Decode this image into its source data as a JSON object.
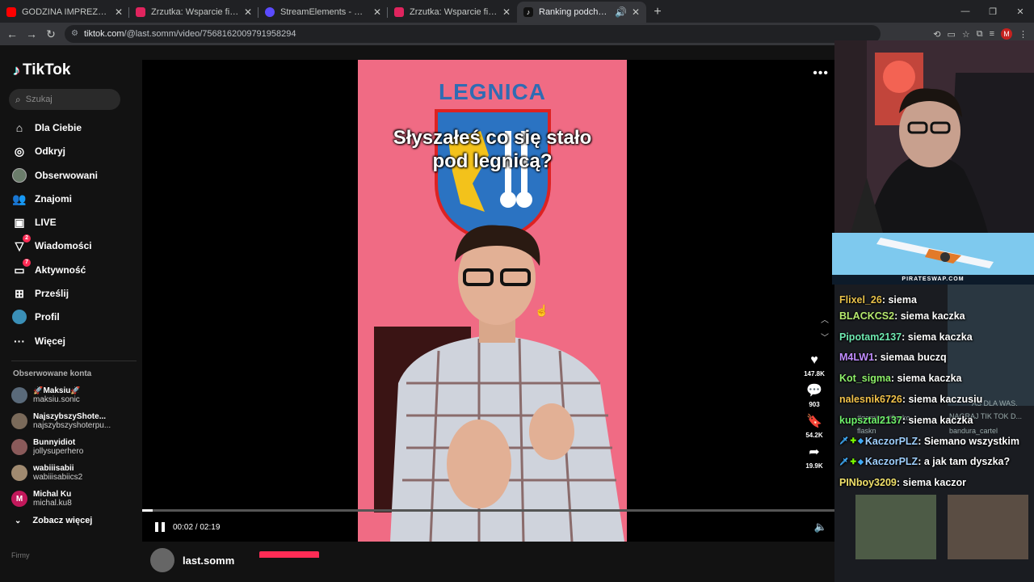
{
  "browser": {
    "tabs": [
      {
        "title": "GODZINA IMPREZY Z DAWIDEM",
        "fav_color": "#ff0000",
        "active": false
      },
      {
        "title": "Zrzutka: Wsparcie finansowe dla",
        "fav_color": "#e0245e",
        "active": false
      },
      {
        "title": "StreamElements - Custom comma",
        "fav_color": "#5b4bff",
        "active": false
      },
      {
        "title": "Zrzutka: Wsparcie finansowe dla",
        "fav_color": "#e0245e",
        "active": false
      },
      {
        "title": "Ranking podchwytliwych py",
        "fav_color": "#111111",
        "active": true
      }
    ],
    "url_host": "tiktok.com",
    "url_path": "/@last.somm/video/7568162009791958294",
    "profile_initial": "M"
  },
  "tiktok": {
    "logo": "TikTok",
    "search_placeholder": "Szukaj",
    "nav": [
      {
        "label": "Dla Ciebie",
        "icon": "home-icon"
      },
      {
        "label": "Odkryj",
        "icon": "compass-icon"
      },
      {
        "label": "Obserwowani",
        "icon": "following-avatar-icon"
      },
      {
        "label": "Znajomi",
        "icon": "friends-icon"
      },
      {
        "label": "LIVE",
        "icon": "live-icon"
      },
      {
        "label": "Wiadomości",
        "icon": "messages-icon",
        "badge": "2"
      },
      {
        "label": "Aktywność",
        "icon": "activity-icon",
        "badge": "7"
      },
      {
        "label": "Prześlij",
        "icon": "upload-icon"
      },
      {
        "label": "Profil",
        "icon": "profile-icon"
      },
      {
        "label": "Więcej",
        "icon": "more-icon"
      }
    ],
    "followed_title": "Obserwowane konta",
    "followed": [
      {
        "name": "🚀Maksiu🚀",
        "handle": "maksiu.sonic",
        "color": "#5a6a7a"
      },
      {
        "name": "NajszybszyShote...",
        "handle": "najszybszyshoterpu...",
        "color": "#7a6a5a"
      },
      {
        "name": "Bunnyidiot",
        "handle": "jollysuperhero",
        "color": "#8a5a5a"
      },
      {
        "name": "wabiiisabii",
        "handle": "wabiiisabiics2",
        "color": "#a08a70"
      },
      {
        "name": "Michal Ku",
        "handle": "michal.ku8",
        "color": "#c2185b",
        "initial": "M"
      }
    ],
    "see_more": "Zobacz więcej",
    "footer": "Firmy",
    "video": {
      "overlay_title": "LEGNICA",
      "caption": "Słyszałeś co się stało pod legnicą?",
      "time": "00:02 / 02:19",
      "progress": 0.015,
      "likes": "147.8K",
      "comments": "903",
      "saves": "54.2K",
      "shares": "19.9K"
    },
    "author": "last.somm"
  },
  "stream": {
    "ad_text": "PIRATESWAP.COM",
    "chat": [
      {
        "user": "Flixel_26",
        "text": "siema",
        "color": "#e8c14a"
      },
      {
        "user": "BLACKCS2",
        "text": "siema kaczka",
        "color": "#b5e86e"
      },
      {
        "user": "Pipotam2137",
        "text": "siema kaczka",
        "color": "#6ee8b0"
      },
      {
        "user": "M4LW1",
        "text": "siemaa buczq",
        "color": "#c08cff"
      },
      {
        "user": "Kot_sigma",
        "text": "siema kaczka",
        "color": "#8ef06a"
      },
      {
        "user": "nalesnik6726",
        "text": "siema kaczusiu",
        "color": "#f0c14a"
      },
      {
        "user": "kupsztal2137",
        "text": "siema kaczka",
        "color": "#6ef06a"
      },
      {
        "user": "KaczorPLZ",
        "text": "Siemano wszystkim",
        "color": "#9fd0ff",
        "badges": true
      },
      {
        "user": "KaczorPLZ",
        "text": "a jak tam dyszka?",
        "color": "#9fd0ff",
        "badges": true
      },
      {
        "user": "PINboy3209",
        "text": "siema kaczor",
        "color": "#f0e06a"
      }
    ],
    "ghost_texts": [
      "NAGRAJ TIK TOK D...",
      "AS DLA WAS.",
      "#gaming #flasko",
      "flaskn",
      "bandura_cartel"
    ]
  }
}
